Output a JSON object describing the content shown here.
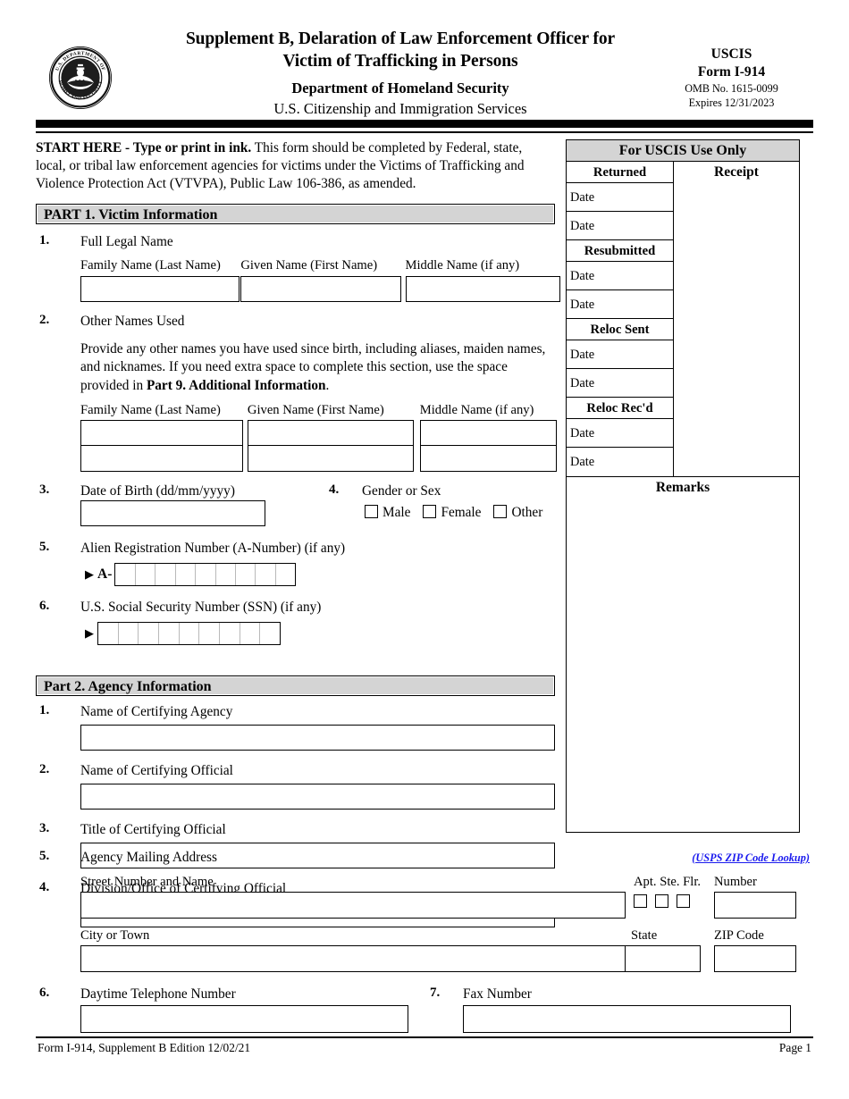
{
  "header": {
    "seal_alt": "dhs-seal",
    "seal_text_top": "U.S. DEPARTMENT OF",
    "seal_text_bottom": "HOMELAND SECURITY",
    "title_line1": "Supplement B, Delaration of Law Enforcement Officer for",
    "title_line2": "Victim of Trafficking in Persons",
    "agency_line1": "Department of Homeland Security",
    "agency_line2": "U.S. Citizenship and Immigration Services",
    "uscis_label": "USCIS",
    "form_label": "Form I-914",
    "omb_number": "OMB No. 1615-0099",
    "expires": "Expires 12/31/2023"
  },
  "start_here": {
    "bold_prefix": "START HERE  - Type or print in ink.",
    "body": "  This form should be completed by Federal, state, local, or tribal law enforcement agencies for victims under the Victims of Trafficking and Violence Protection Act (VTVPA), Public Law 106-386, as amended."
  },
  "part1": {
    "header": "PART 1.  Victim Information",
    "item1": {
      "number": "1.",
      "label": "Full Legal Name",
      "col_family": "Family Name (Last Name)",
      "col_given": "Given Name (First Name)",
      "col_middle": "Middle Name (if any)",
      "value_family": "",
      "value_given": "",
      "value_middle": ""
    },
    "item2": {
      "number": "2.",
      "label": "Other Names Used",
      "instructions_a": "Provide any other names you have used since birth, including aliases, maiden names, and nicknames.  If you need extra space to complete this section, use the space provided in ",
      "instructions_bold": "Part 9. Additional Information",
      "instructions_b": ".",
      "col_family": "Family Name (Last Name)",
      "col_given": "Given Name (First Name)",
      "col_middle": "Middle Name (if any)",
      "rows": [
        {
          "family": "",
          "given": "",
          "middle": ""
        },
        {
          "family": "",
          "given": "",
          "middle": ""
        }
      ]
    },
    "item3": {
      "number": "3.",
      "label": "Date of Birth (dd/mm/yyyy)",
      "value": ""
    },
    "item4": {
      "number": "4.",
      "label": "Gender or Sex",
      "options": [
        "Male",
        "Female",
        "Other"
      ]
    },
    "item5": {
      "number": "5.",
      "label": "Alien Registration Number (A-Number) (if any)",
      "prefix": "A-",
      "cell_count": 9,
      "value": ""
    },
    "item6": {
      "number": "6.",
      "label": "U.S. Social Security Number (SSN) (if any)",
      "cell_count": 9,
      "value": ""
    }
  },
  "part2": {
    "header": "Part 2.  Agency Information",
    "item1": {
      "number": "1.",
      "label": "Name of Certifying Agency",
      "value": ""
    },
    "item2": {
      "number": "2.",
      "label": "Name of Certifying Official",
      "value": ""
    },
    "item3": {
      "number": "3.",
      "label": "Title of Certifying Official",
      "value": ""
    },
    "item4": {
      "number": "4.",
      "label": "Division/Office of Certifying Official",
      "value": ""
    },
    "item5": {
      "number": "5.",
      "label": "Agency Mailing Address",
      "zip_lookup_link": "(USPS ZIP Code Lookup)",
      "street_label": "Street Number and Name",
      "street_value": "",
      "unit_options": [
        "Apt.",
        "Ste.",
        "Flr."
      ],
      "unit_number_label": "Number",
      "unit_number_value": "",
      "city_label": "City or Town",
      "city_value": "",
      "state_label": "State",
      "state_value": "",
      "zip_label": "ZIP Code",
      "zip_value": ""
    },
    "item6": {
      "number": "6.",
      "label": "Daytime Telephone Number",
      "value": ""
    },
    "item7": {
      "number": "7.",
      "label": "Fax Number",
      "value": ""
    }
  },
  "uscis_box": {
    "title": "For USCIS Use Only",
    "returned_header": "Returned",
    "resubmitted_header": "Resubmitted",
    "reloc_sent_header": "Reloc Sent",
    "reloc_recd_header": "Reloc Rec'd",
    "date_label": "Date",
    "receipt_header": "Receipt",
    "remarks_header": "Remarks"
  },
  "footer": {
    "left": "Form I-914, Supplement B   Edition   12/02/21",
    "right": "Page 1"
  },
  "colors": {
    "section_bar": "#d4d4d4",
    "link": "#1a1aee",
    "border": "#000000"
  }
}
